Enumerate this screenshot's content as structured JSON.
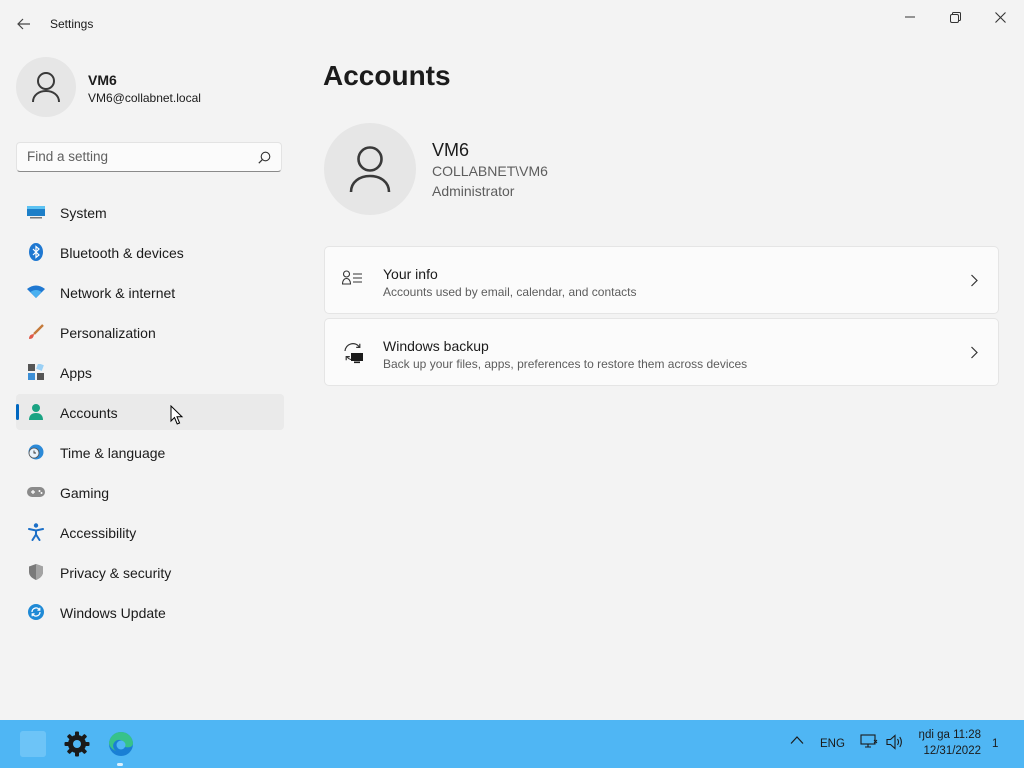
{
  "window": {
    "title": "Settings"
  },
  "profile": {
    "name": "VM6",
    "email": "VM6@collabnet.local"
  },
  "search": {
    "placeholder": "Find a setting",
    "value": ""
  },
  "sidebar": {
    "items": [
      {
        "label": "System",
        "icon": "monitor-icon"
      },
      {
        "label": "Bluetooth & devices",
        "icon": "bluetooth-icon"
      },
      {
        "label": "Network & internet",
        "icon": "wifi-icon"
      },
      {
        "label": "Personalization",
        "icon": "brush-icon"
      },
      {
        "label": "Apps",
        "icon": "apps-icon"
      },
      {
        "label": "Accounts",
        "icon": "person-icon",
        "selected": true
      },
      {
        "label": "Time & language",
        "icon": "clock-globe-icon"
      },
      {
        "label": "Gaming",
        "icon": "gamepad-icon"
      },
      {
        "label": "Accessibility",
        "icon": "accessibility-icon"
      },
      {
        "label": "Privacy & security",
        "icon": "shield-icon"
      },
      {
        "label": "Windows Update",
        "icon": "update-icon"
      }
    ]
  },
  "main": {
    "title": "Accounts",
    "account": {
      "name": "VM6",
      "domain": "COLLABNET\\VM6",
      "role": "Administrator"
    },
    "cards": [
      {
        "title": "Your info",
        "description": "Accounts used by email, calendar, and contacts",
        "icon": "contact-card-icon"
      },
      {
        "title": "Windows backup",
        "description": "Back up your files, apps, preferences to restore them across devices",
        "icon": "backup-sync-icon"
      }
    ]
  },
  "taskbar": {
    "apps": [
      "start-icon",
      "settings-gear-icon",
      "edge-browser-icon"
    ],
    "tray": {
      "language": "ENG",
      "time": "ŋdi ga 11:28",
      "date": "12/31/2022",
      "notifications": "1"
    }
  },
  "colors": {
    "accent": "#0067c0",
    "taskbar": "#4fb6f4",
    "background": "#f3f3f3",
    "card": "#fbfbfb"
  }
}
